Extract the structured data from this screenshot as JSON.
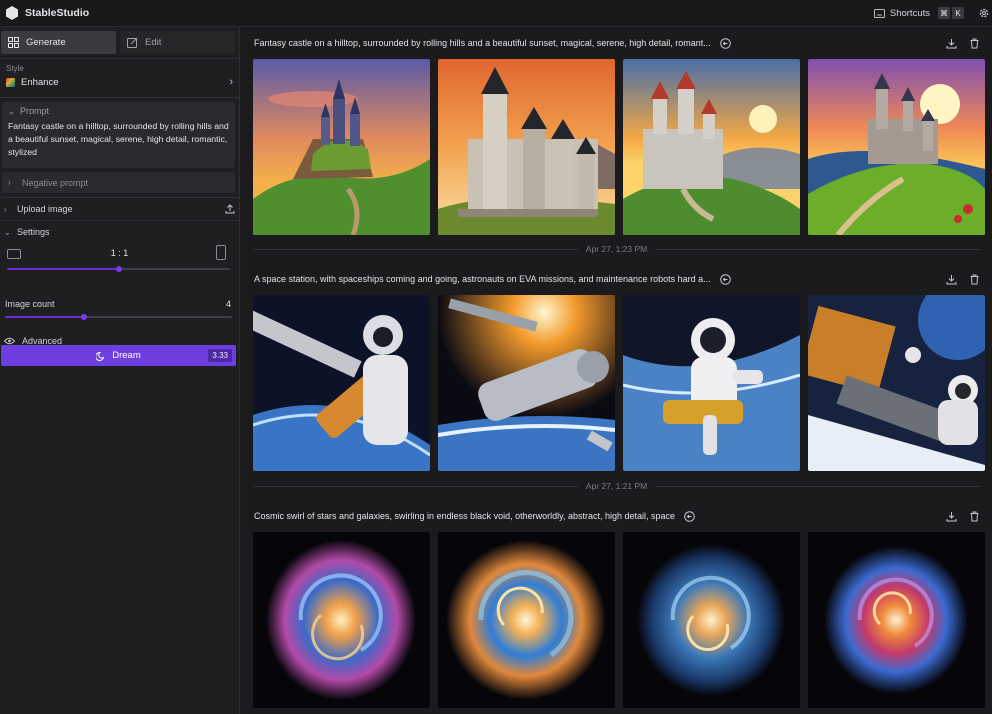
{
  "app": {
    "title": "StableStudio"
  },
  "topbar": {
    "shortcuts_label": "Shortcuts",
    "key1": "⌘",
    "key2": "K"
  },
  "sidebar": {
    "tabs": [
      {
        "label": "Generate"
      },
      {
        "label": "Edit"
      }
    ],
    "style": {
      "label": "Style",
      "value": "Enhance"
    },
    "prompt": {
      "label": "Prompt",
      "text": "Fantasy castle on a hilltop, surrounded by rolling hills and a beautiful sunset, magical, serene, high detail, romantic, stylized"
    },
    "negative_prompt_label": "Negative prompt",
    "upload_label": "Upload image",
    "settings_label": "Settings",
    "aspect_ratio": "1 : 1",
    "aspect_ratio_level": 0.5,
    "image_count": {
      "label": "Image count",
      "value": "4",
      "level": 0.35
    },
    "advanced_label": "Advanced",
    "dream": {
      "label": "Dream",
      "cost": "3.33"
    }
  },
  "colors": {
    "accent": "#6d3ee0",
    "background": "#1b1b1e",
    "sidebar": "#1f1f22"
  },
  "generations": [
    {
      "prompt": "Fantasy castle on a hilltop, surrounded by rolling hills and a beautiful sunset, magical, serene, high detail, romant...",
      "timestamp": "Apr 27, 1:23 PM",
      "images": [
        "castle-sunset-1",
        "castle-sunset-2",
        "castle-sunset-3",
        "castle-sunset-4"
      ]
    },
    {
      "prompt": "A space station, with spaceships coming and going, astronauts on EVA missions, and maintenance robots hard a...",
      "timestamp": "Apr 27, 1:21 PM",
      "images": [
        "space-station-1",
        "space-station-2",
        "astronaut-eva-3",
        "space-station-4"
      ]
    },
    {
      "prompt": "Cosmic swirl of stars and galaxies, swirling in endless black void, otherworldly, abstract, high detail, space",
      "timestamp": "",
      "images": [
        "galaxy-swirl-1",
        "galaxy-swirl-2",
        "galaxy-swirl-3",
        "galaxy-swirl-4"
      ]
    }
  ]
}
